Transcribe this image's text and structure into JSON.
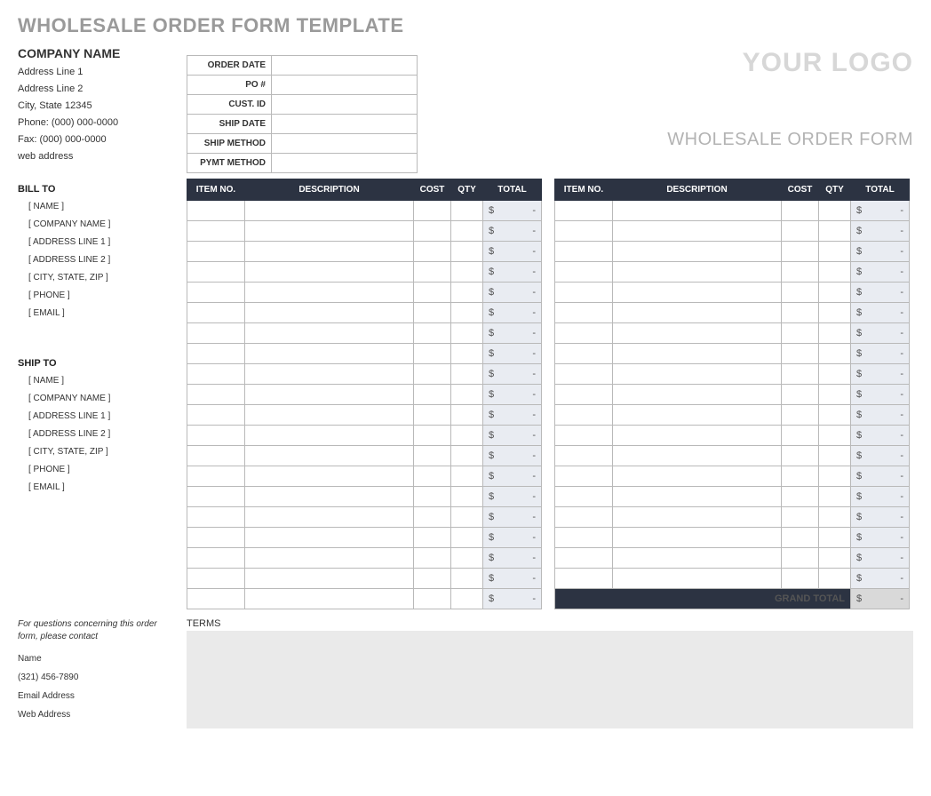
{
  "title": "WHOLESALE ORDER FORM TEMPLATE",
  "company": {
    "name": "COMPANY NAME",
    "addr1": "Address Line 1",
    "addr2": "Address Line 2",
    "citystate": "City, State  12345",
    "phone": "Phone: (000) 000-0000",
    "fax": "Fax: (000) 000-0000",
    "web": "web address"
  },
  "meta_labels": {
    "order_date": "ORDER DATE",
    "po": "PO #",
    "cust_id": "CUST. ID",
    "ship_date": "SHIP DATE",
    "ship_method": "SHIP METHOD",
    "pymt_method": "PYMT METHOD"
  },
  "logo_text": "YOUR LOGO",
  "form_heading": "WHOLESALE ORDER FORM",
  "columns": {
    "item_no": "ITEM NO.",
    "description": "DESCRIPTION",
    "cost": "COST",
    "qty": "QTY",
    "total": "TOTAL"
  },
  "bill_to": {
    "heading": "BILL TO",
    "fields": [
      "[ NAME ]",
      "[ COMPANY NAME ]",
      "[ ADDRESS LINE 1 ]",
      "[ ADDRESS LINE 2 ]",
      "[ CITY, STATE, ZIP ]",
      "[ PHONE ]",
      "[ EMAIL ]"
    ]
  },
  "ship_to": {
    "heading": "SHIP TO",
    "fields": [
      "[ NAME ]",
      "[ COMPANY NAME ]",
      "[ ADDRESS LINE 1 ]",
      "[ ADDRESS LINE 2 ]",
      "[ CITY, STATE, ZIP ]",
      "[ PHONE ]",
      "[ EMAIL ]"
    ]
  },
  "currency": "$",
  "empty_amount": "-",
  "left_rows": 20,
  "right_rows": 19,
  "grand_total_label": "GRAND TOTAL",
  "contact": {
    "note": "For questions concerning this order form, please contact",
    "name": "Name",
    "phone": "(321) 456-7890",
    "email": "Email Address",
    "web": "Web Address"
  },
  "terms_label": "TERMS"
}
